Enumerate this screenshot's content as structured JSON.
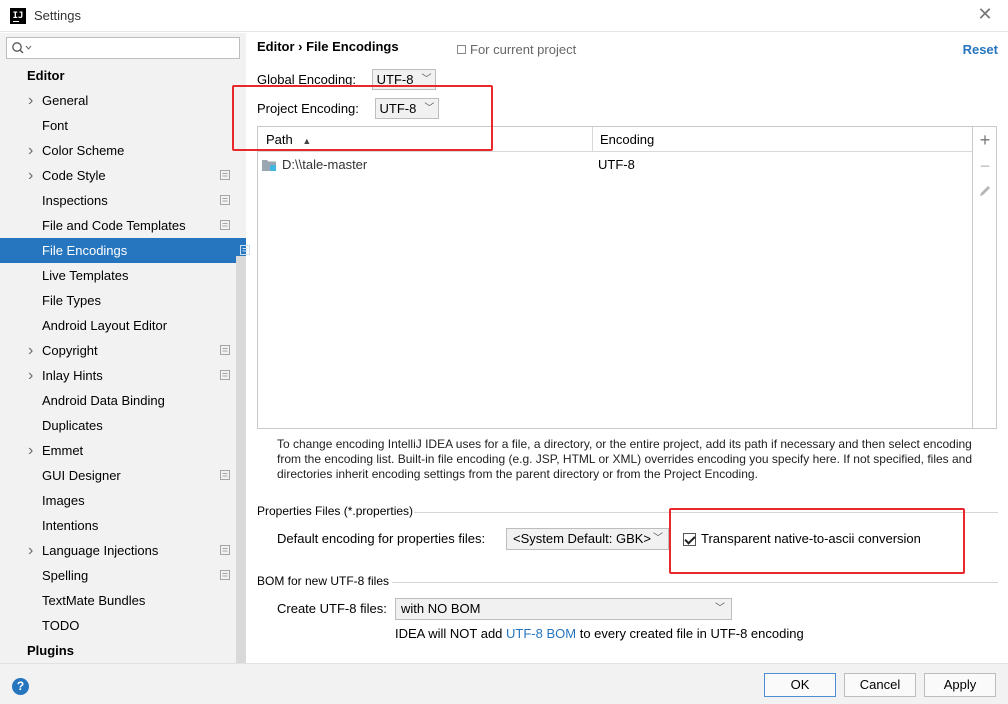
{
  "window": {
    "title": "Settings",
    "app_icon_text": "IJ"
  },
  "sidebar": {
    "items": [
      {
        "label": "Editor",
        "group": true
      },
      {
        "label": "General",
        "chevron": true
      },
      {
        "label": "Font"
      },
      {
        "label": "Color Scheme",
        "chevron": true
      },
      {
        "label": "Code Style",
        "chevron": true,
        "proj": true
      },
      {
        "label": "Inspections",
        "proj": true
      },
      {
        "label": "File and Code Templates",
        "proj": true
      },
      {
        "label": "File Encodings",
        "proj": true,
        "selected": true
      },
      {
        "label": "Live Templates"
      },
      {
        "label": "File Types"
      },
      {
        "label": "Android Layout Editor"
      },
      {
        "label": "Copyright",
        "chevron": true,
        "proj": true
      },
      {
        "label": "Inlay Hints",
        "chevron": true,
        "proj": true
      },
      {
        "label": "Android Data Binding"
      },
      {
        "label": "Duplicates"
      },
      {
        "label": "Emmet",
        "chevron": true
      },
      {
        "label": "GUI Designer",
        "proj": true
      },
      {
        "label": "Images"
      },
      {
        "label": "Intentions"
      },
      {
        "label": "Language Injections",
        "chevron": true,
        "proj": true
      },
      {
        "label": "Spelling",
        "proj": true
      },
      {
        "label": "TextMate Bundles"
      },
      {
        "label": "TODO"
      },
      {
        "label": "Plugins",
        "group": true
      }
    ]
  },
  "main": {
    "breadcrumb": "Editor  ›  File Encodings",
    "scope_note": "For current project",
    "reset_label": "Reset",
    "global_encoding": {
      "label": "Global Encoding:",
      "value": "UTF-8"
    },
    "project_encoding": {
      "label": "Project Encoding:",
      "value": "UTF-8"
    },
    "table": {
      "col_path": "Path",
      "col_encoding": "Encoding",
      "rows": [
        {
          "path": "D:\\\\tale-master",
          "encoding": "UTF-8"
        }
      ]
    },
    "help_text": "To change encoding IntelliJ IDEA uses for a file, a directory, or the entire project, add its path if necessary and then select encoding from the encoding list. Built-in file encoding (e.g. JSP, HTML or XML) overrides encoding you specify here. If not specified, files and directories inherit encoding settings from the parent directory or from the Project Encoding.",
    "properties": {
      "section_label": "Properties Files (*.properties)",
      "default_label": "Default encoding for properties files:",
      "default_value": "<System Default: GBK>",
      "transparent_label": "Transparent native-to-ascii conversion",
      "transparent_checked": true
    },
    "bom": {
      "section_label": "BOM for new UTF-8 files",
      "create_label": "Create UTF-8 files:",
      "create_value": "with NO BOM",
      "note_prefix": "IDEA will NOT add ",
      "note_link": "UTF-8 BOM",
      "note_suffix": " to every created file in UTF-8 encoding"
    }
  },
  "footer": {
    "ok_label": "OK",
    "cancel_label": "Cancel",
    "apply_label": "Apply"
  },
  "colors": {
    "accent": "#2675bf",
    "highlight_box": "#e8292c",
    "sidebar_bg": "#f2f2f2"
  }
}
